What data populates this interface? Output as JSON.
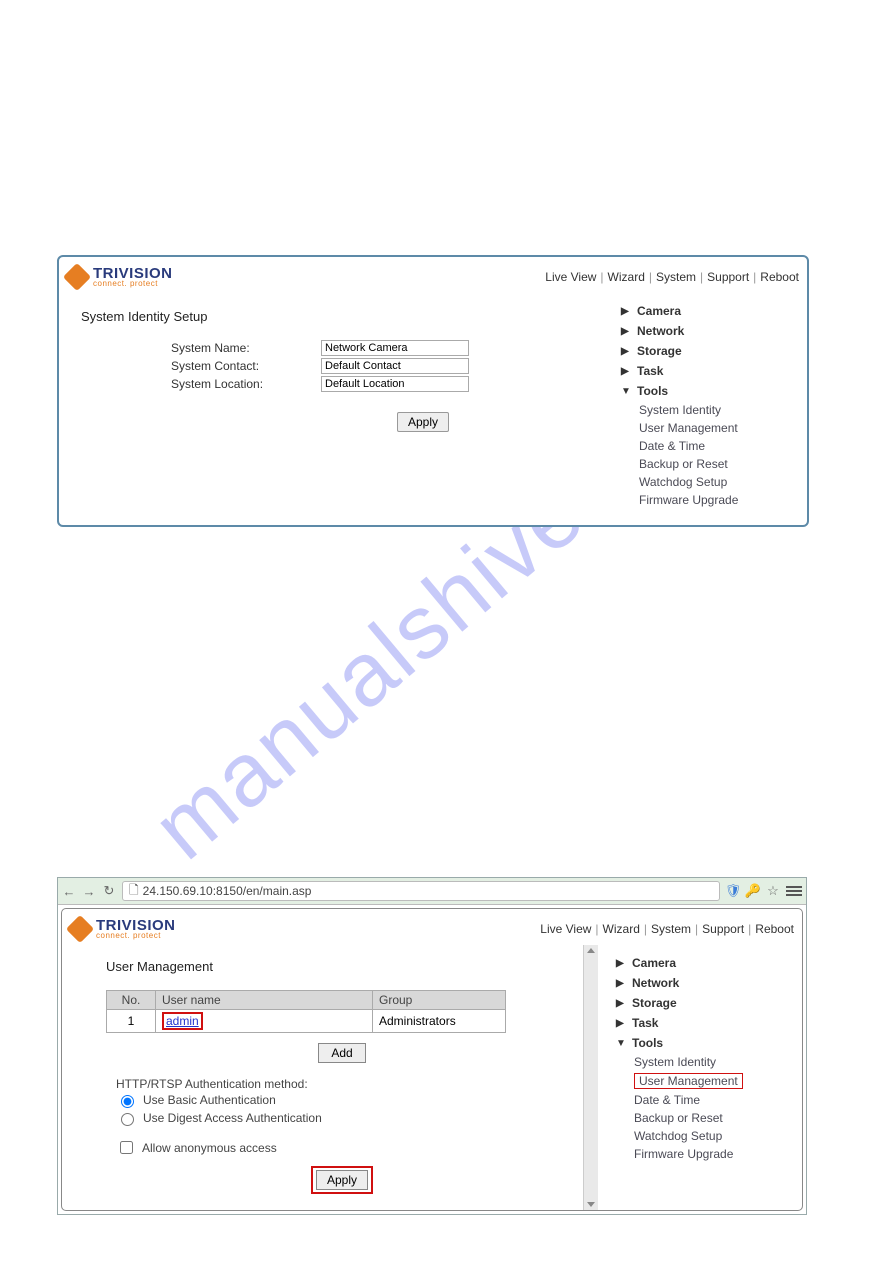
{
  "watermark": "manualshive.com",
  "logo": {
    "word": "TRIVISION",
    "tagline": "connect. protect"
  },
  "nav": {
    "live_view": "Live View",
    "wizard": "Wizard",
    "system": "System",
    "support": "Support",
    "reboot": "Reboot"
  },
  "panel1": {
    "title": "System Identity Setup",
    "fields": {
      "name_label": "System Name:",
      "name_value": "Network Camera",
      "contact_label": "System Contact:",
      "contact_value": "Default Contact",
      "location_label": "System Location:",
      "location_value": "Default Location"
    },
    "apply": "Apply"
  },
  "tree": {
    "camera": "Camera",
    "network": "Network",
    "storage": "Storage",
    "task": "Task",
    "tools": "Tools",
    "tools_sub": {
      "system_identity": "System Identity",
      "user_management": "User Management",
      "date_time": "Date & Time",
      "backup_reset": "Backup or Reset",
      "watchdog": "Watchdog Setup",
      "firmware": "Firmware Upgrade"
    }
  },
  "browser": {
    "url": "24.150.69.10:8150/en/main.asp"
  },
  "panel2": {
    "title": "User Management",
    "table": {
      "headers": {
        "no": "No.",
        "username": "User name",
        "group": "Group"
      },
      "row1": {
        "no": "1",
        "username": "admin",
        "group": "Administrators"
      }
    },
    "add": "Add",
    "auth_title": "HTTP/RTSP Authentication method:",
    "basic": "Use Basic Authentication",
    "digest": "Use Digest Access Authentication",
    "anon": "Allow anonymous access",
    "apply": "Apply"
  }
}
